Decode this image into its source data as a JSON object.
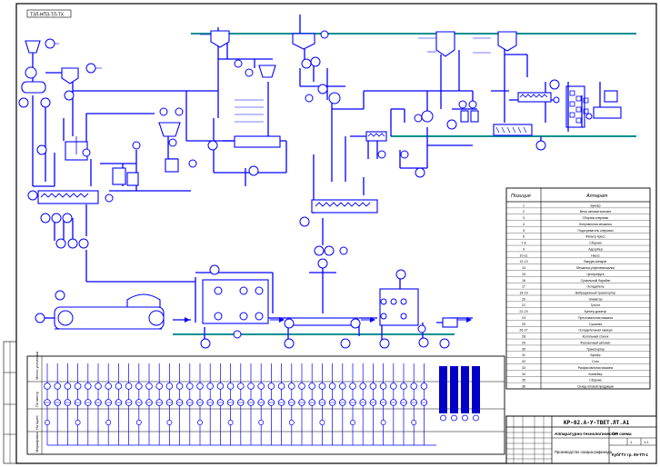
{
  "drawing": {
    "stamp_top_left": "ТЗЛ-НПЗ-ТЛ-ТХ",
    "designation": "КР-02.А-У-ТВЕТ.ЛТ.А1",
    "sheet_title": "Аппаратурно-технологическая схема",
    "bottom_title": "Производство сахара-рафинада",
    "stage_label": "Лит."
  },
  "legend": {
    "header_code": "Позиция",
    "header_name": "Аппарат",
    "rows": [
      {
        "code": "1",
        "name": "Бункер"
      },
      {
        "code": "2",
        "name": "Весы автоматические"
      },
      {
        "code": "3",
        "name": "Сборник клеровки"
      },
      {
        "code": "4",
        "name": "Клеровочная мешалка"
      },
      {
        "code": "5",
        "name": "Подогреватель клеровки"
      },
      {
        "code": "6",
        "name": "Фильтр-пресс"
      },
      {
        "code": "7-8",
        "name": "Сборник"
      },
      {
        "code": "9",
        "name": "Адсорбер"
      },
      {
        "code": "10-11",
        "name": "Насос"
      },
      {
        "code": "12-13",
        "name": "Вакуум-аппарат"
      },
      {
        "code": "14",
        "name": "Мешалка-утфелемешалка"
      },
      {
        "code": "15",
        "name": "Центрифуга"
      },
      {
        "code": "16",
        "name": "Сушильный барабан"
      },
      {
        "code": "17",
        "name": "Охладитель"
      },
      {
        "code": "18-19",
        "name": "Вибрационный транспортер"
      },
      {
        "code": "20",
        "name": "Элеватор"
      },
      {
        "code": "21",
        "name": "Грохот"
      },
      {
        "code": "22-23",
        "name": "Бункер-дозатор"
      },
      {
        "code": "24",
        "name": "Прессовальная машина"
      },
      {
        "code": "25",
        "name": "Сушилка"
      },
      {
        "code": "26-27",
        "name": "Охладительная камера"
      },
      {
        "code": "28",
        "name": "Колольный станок"
      },
      {
        "code": "29",
        "name": "Фасовочный автомат"
      },
      {
        "code": "30",
        "name": "Транспортер"
      },
      {
        "code": "31",
        "name": "Бункер"
      },
      {
        "code": "32",
        "name": "Сито"
      },
      {
        "code": "33",
        "name": "Расфасовочная машина"
      },
      {
        "code": "34",
        "name": "Конвейер"
      },
      {
        "code": "35",
        "name": "Сборник"
      },
      {
        "code": "36",
        "name": "Склад готовой продукции"
      }
    ]
  },
  "title_block": {
    "sheet": "1",
    "sheets": "1",
    "scale": "1:1",
    "org": "КубГТУ гр. 09-ТП-1"
  },
  "instrument_strip": {
    "row_labels": [
      "Место установки",
      "По месту",
      "На щите",
      "Маркировка"
    ]
  },
  "colors": {
    "process_line": "#0000ff",
    "water_line": "#009090",
    "frame": "#000000",
    "heating_medium": "#c58a2a"
  }
}
